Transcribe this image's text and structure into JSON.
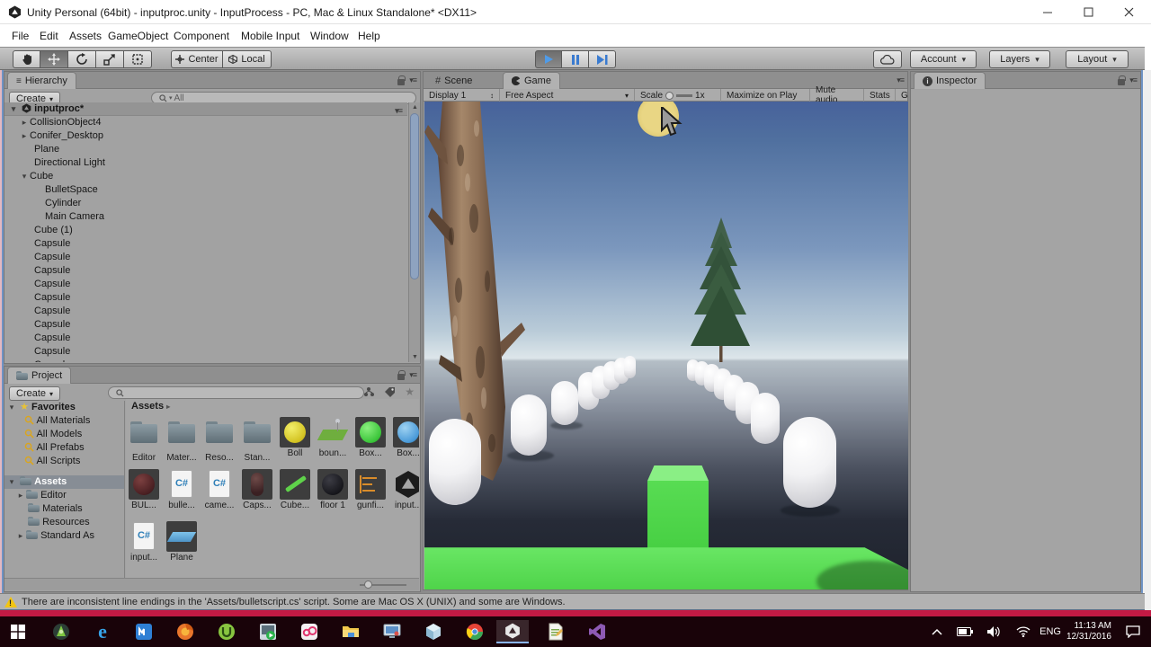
{
  "window": {
    "title": "Unity Personal (64bit) - inputproc.unity - InputProcess - PC, Mac & Linux Standalone* <DX11>"
  },
  "menu": {
    "items": [
      "File",
      "Edit",
      "Assets",
      "GameObject",
      "Component",
      "Mobile Input",
      "Window",
      "Help"
    ]
  },
  "toolbar": {
    "center_label": "Center",
    "local_label": "Local",
    "account_label": "Account",
    "layers_label": "Layers",
    "layout_label": "Layout"
  },
  "hierarchy": {
    "tab": "Hierarchy",
    "create_label": "Create",
    "search_text": "All",
    "items": [
      {
        "label": "inputproc*"
      },
      {
        "label": "CollisionObject4"
      },
      {
        "label": "Conifer_Desktop"
      },
      {
        "label": "Plane"
      },
      {
        "label": "Directional Light"
      },
      {
        "label": "Cube"
      },
      {
        "label": "BulletSpace"
      },
      {
        "label": "Cylinder"
      },
      {
        "label": "Main Camera"
      },
      {
        "label": "Cube (1)"
      },
      {
        "label": "Capsule"
      },
      {
        "label": "Capsule"
      },
      {
        "label": "Capsule"
      },
      {
        "label": "Capsule"
      },
      {
        "label": "Capsule"
      },
      {
        "label": "Capsule"
      },
      {
        "label": "Capsule"
      },
      {
        "label": "Capsule"
      },
      {
        "label": "Capsule"
      },
      {
        "label": "Capsule"
      }
    ]
  },
  "project": {
    "tab": "Project",
    "create_label": "Create",
    "favorites_label": "Favorites",
    "favorites": [
      "All Materials",
      "All Models",
      "All Prefabs",
      "All Scripts"
    ],
    "assets_root": "Assets",
    "tree": [
      "Editor",
      "Materials",
      "Resources",
      "Standard As"
    ],
    "breadcrumb": "Assets",
    "assets": [
      {
        "label": "Editor",
        "icon": "folder"
      },
      {
        "label": "Mater...",
        "icon": "folder"
      },
      {
        "label": "Reso...",
        "icon": "folder"
      },
      {
        "label": "Stan...",
        "icon": "folder"
      },
      {
        "label": "Boll",
        "icon": "sphere-yellow"
      },
      {
        "label": "boun...",
        "icon": "plane-pin"
      },
      {
        "label": "Box...",
        "icon": "sphere-green"
      },
      {
        "label": "Box...",
        "icon": "sphere-blue"
      },
      {
        "label": "BUL...",
        "icon": "sphere-darkred"
      },
      {
        "label": "bulle...",
        "icon": "csharp-script"
      },
      {
        "label": "came...",
        "icon": "csharp-script"
      },
      {
        "label": "Caps...",
        "icon": "capsule-dark"
      },
      {
        "label": "Cube...",
        "icon": "material-green"
      },
      {
        "label": "floor 1",
        "icon": "sphere-black"
      },
      {
        "label": "gunfi...",
        "icon": "animation-orange"
      },
      {
        "label": "input...",
        "icon": "unity-scene"
      },
      {
        "label": "input...",
        "icon": "csharp-script"
      },
      {
        "label": "Plane",
        "icon": "plane-blue"
      }
    ]
  },
  "game": {
    "scene_tab": "Scene",
    "game_tab": "Game",
    "display": "Display 1",
    "aspect": "Free Aspect",
    "scale_label": "Scale",
    "scale_value": "1x",
    "maximize_label": "Maximize on Play",
    "mute_label": "Mute audio",
    "stats_label": "Stats",
    "gizmos_label": "G"
  },
  "inspector": {
    "tab": "Inspector"
  },
  "status": {
    "message": "There are inconsistent line endings in the 'Assets/bulletscript.cs' script. Some are Mac OS X (UNIX) and some are Windows."
  },
  "game_scene": {
    "objects": [
      "tree-trunk",
      "pine-tree",
      "sun",
      "white-capsule-rows",
      "green-cube",
      "green-floor",
      "mouse-cursor"
    ],
    "floor_color": "#52d54d",
    "sky_top_color": "#47629b"
  },
  "taskbar": {
    "icons": [
      "start",
      "android-studio",
      "edge",
      "maxthon",
      "firefox",
      "utorrent",
      "media-player",
      "obs",
      "file-explorer",
      "screen-viewer",
      "3d-builder",
      "chrome",
      "unity",
      "notepad",
      "visual-studio"
    ],
    "tray": {
      "language": "ENG",
      "time": "11:13 AM",
      "date": "12/31/2016"
    }
  }
}
